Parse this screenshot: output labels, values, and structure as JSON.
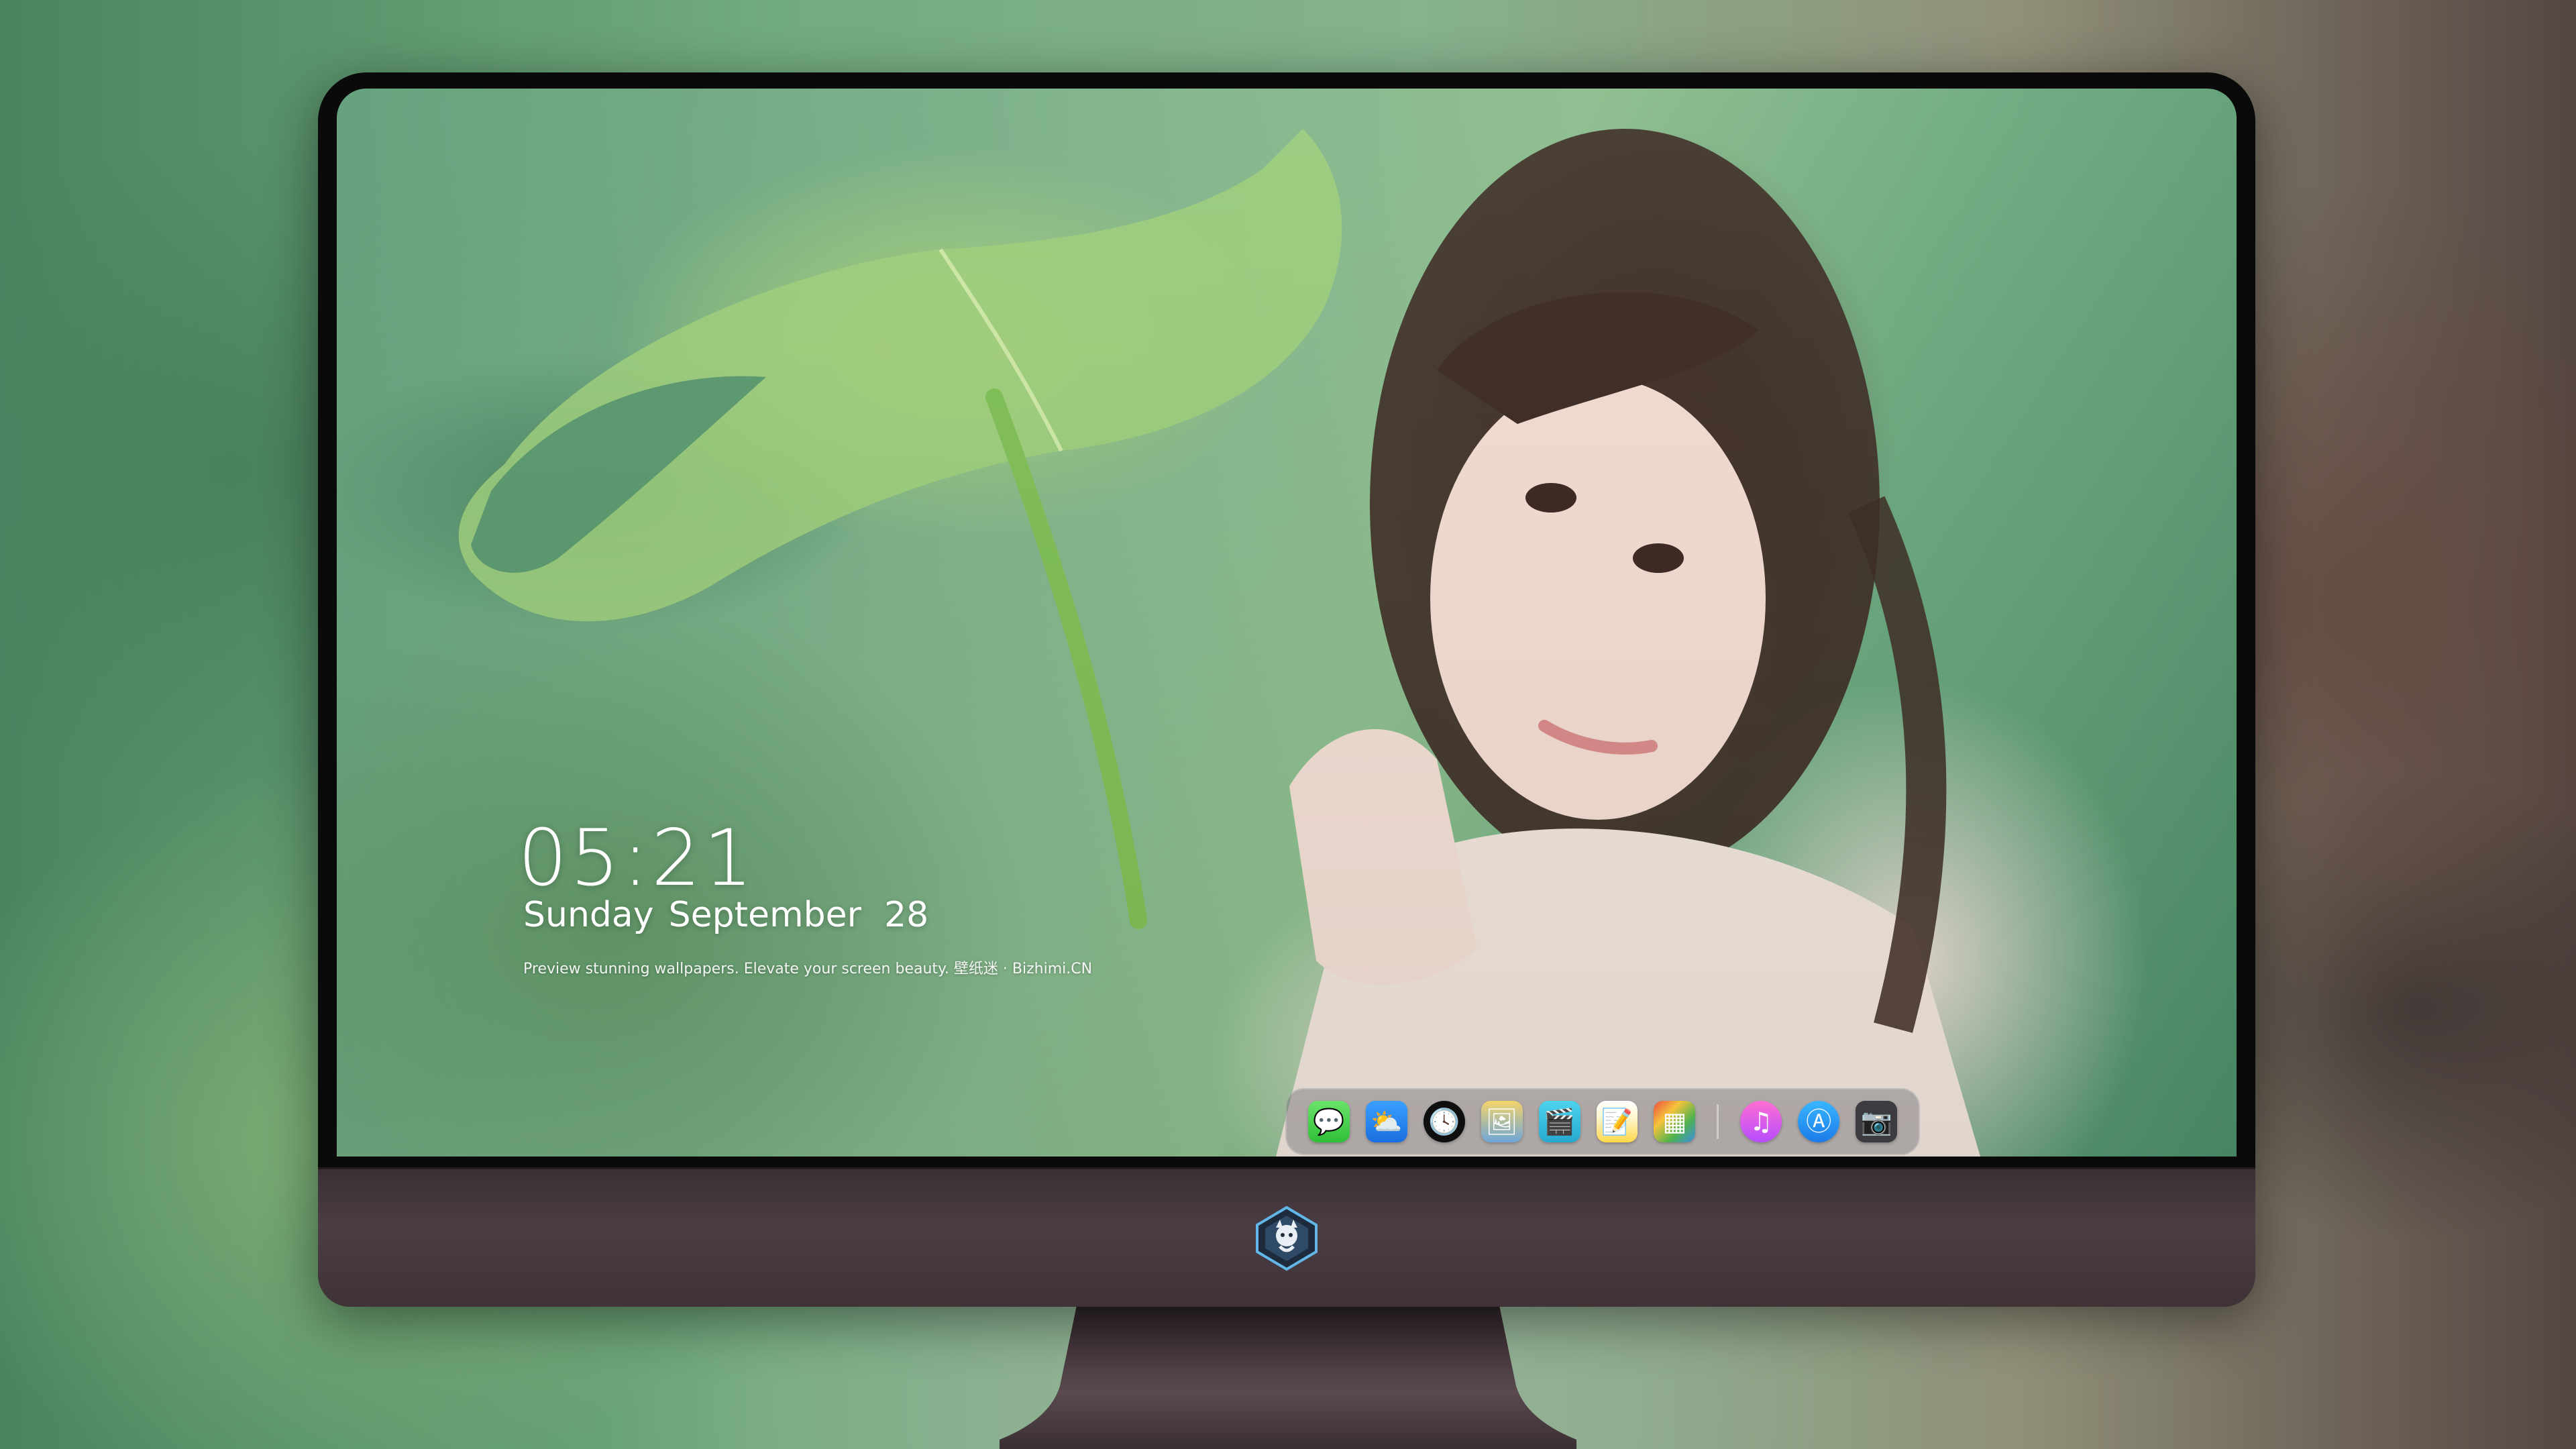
{
  "lockscreen": {
    "time": "05:21",
    "weekday": "Sunday",
    "month": "September",
    "day": "28",
    "caption": "Preview stunning wallpapers. Elevate your screen beauty. 壁纸迷 · Bizhimi.CN"
  },
  "dock": {
    "apps": [
      {
        "name": "messages",
        "icon": "speech-bubble",
        "glyph": "💬"
      },
      {
        "name": "weather",
        "icon": "cloud-sun",
        "glyph": "⛅"
      },
      {
        "name": "clock",
        "icon": "clock-face",
        "glyph": "🕓"
      },
      {
        "name": "preview",
        "icon": "photo-viewer",
        "glyph": "🖼"
      },
      {
        "name": "claquette",
        "icon": "clapperboard",
        "glyph": "🎬"
      },
      {
        "name": "notes",
        "icon": "notepad",
        "glyph": "📝"
      },
      {
        "name": "photo-booth",
        "icon": "photo-grid",
        "glyph": "▦"
      },
      {
        "name": "music",
        "icon": "music-note",
        "glyph": "♫"
      },
      {
        "name": "app-store",
        "icon": "app-store-a",
        "glyph": "Ⓐ"
      },
      {
        "name": "camera",
        "icon": "camera",
        "glyph": "📷"
      }
    ]
  },
  "colors": {
    "bezel": "#0a0a0b",
    "chin": "#3f3338",
    "text": "#ffffff",
    "dock_bg": "rgba(110,110,118,0.45)"
  }
}
